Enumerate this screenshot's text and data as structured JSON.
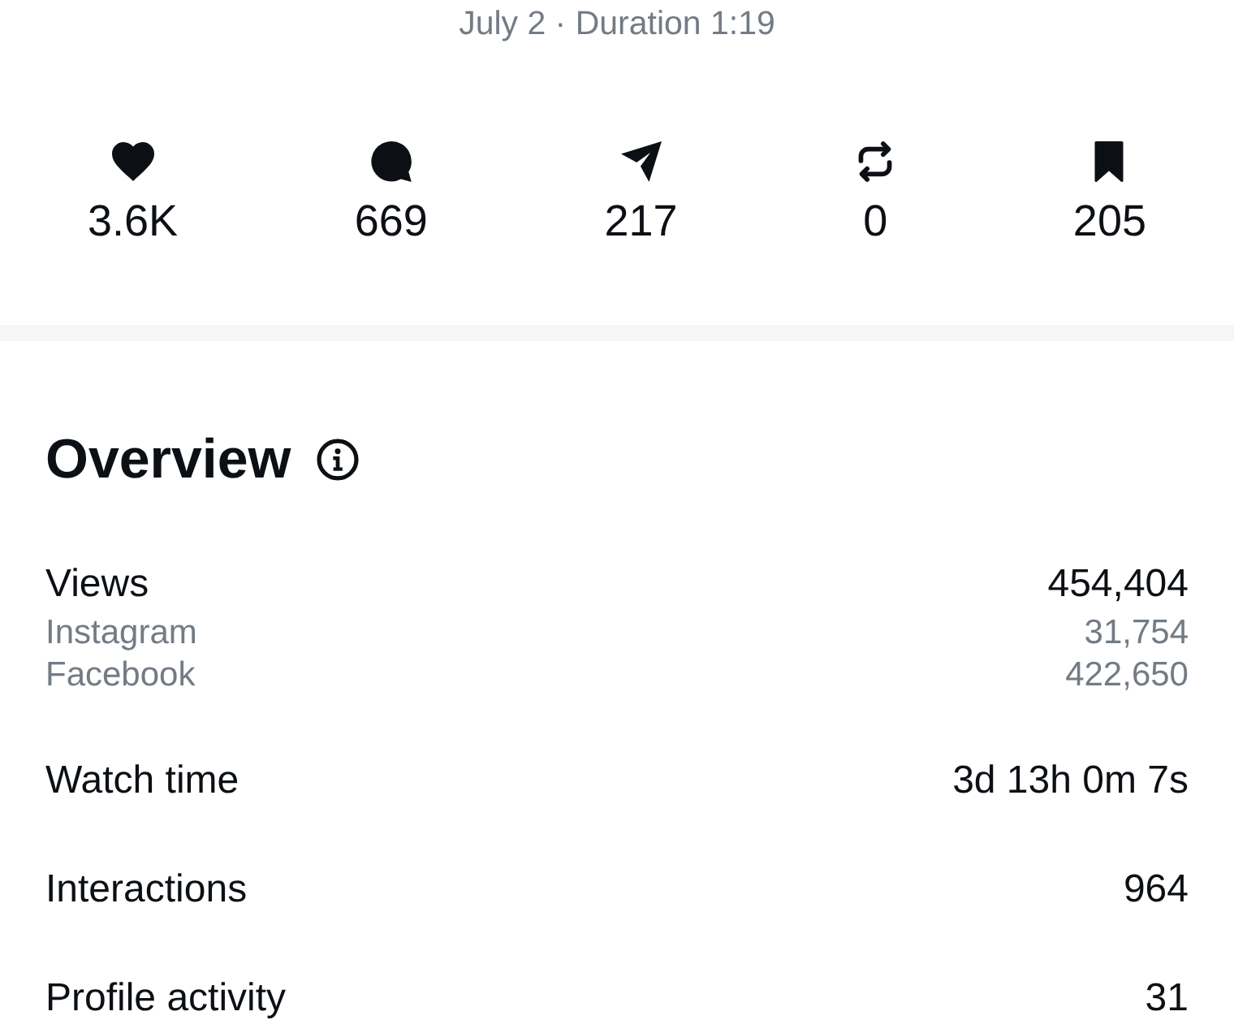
{
  "subtitle": "July 2 · Duration 1:19",
  "stats": [
    {
      "kind": "likes",
      "value": "3.6K"
    },
    {
      "kind": "comments",
      "value": "669"
    },
    {
      "kind": "shares",
      "value": "217"
    },
    {
      "kind": "reposts",
      "value": "0"
    },
    {
      "kind": "saves",
      "value": "205"
    }
  ],
  "overview": {
    "title": "Overview",
    "metrics": [
      {
        "label": "Views",
        "value": "454,404",
        "breakdown": [
          {
            "label": "Instagram",
            "value": "31,754"
          },
          {
            "label": "Facebook",
            "value": "422,650"
          }
        ]
      },
      {
        "label": "Watch time",
        "value": "3d 13h 0m 7s"
      },
      {
        "label": "Interactions",
        "value": "964"
      },
      {
        "label": "Profile activity",
        "value": "31"
      }
    ]
  }
}
